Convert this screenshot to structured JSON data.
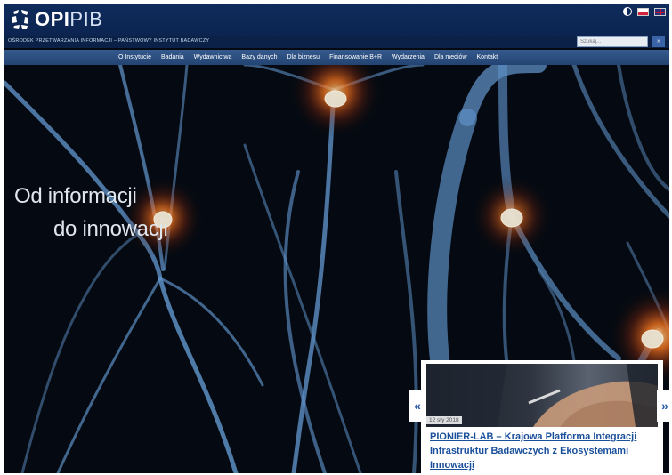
{
  "header": {
    "logo_text": "OPI",
    "logo_text_suffix": "PIB",
    "org_name": "OŚRODEK PRZETWARZANIA INFORMACJI – PAŃSTWOWY INSTYTUT BADAWCZY",
    "search_placeholder": "Szukaj...",
    "search_button": "»"
  },
  "nav": {
    "items": [
      {
        "label": "O Instytucie"
      },
      {
        "label": "Badania"
      },
      {
        "label": "Wydawnictwa"
      },
      {
        "label": "Bazy danych"
      },
      {
        "label": "Dla biznesu"
      },
      {
        "label": "Finansowanie B+R"
      },
      {
        "label": "Wydarzenia"
      },
      {
        "label": "Dla mediów"
      },
      {
        "label": "Kontakt"
      }
    ]
  },
  "hero": {
    "line1": "Od informacji",
    "line2": "do innowacji"
  },
  "news": {
    "date": "12 sty 2018",
    "title": "PIONIER-LAB – Krajowa Platforma Integracji Infrastruktur Badawczych z Ekosystemami Innowacji",
    "prev": "«",
    "next": "»"
  },
  "colors": {
    "header_bg": "#0f2c5c",
    "nav_bg": "#2c4f82",
    "hero_bg": "#050a12",
    "link": "#1a4f9a",
    "neuron": "#6f9fd0",
    "glow": "#ff7a20"
  }
}
